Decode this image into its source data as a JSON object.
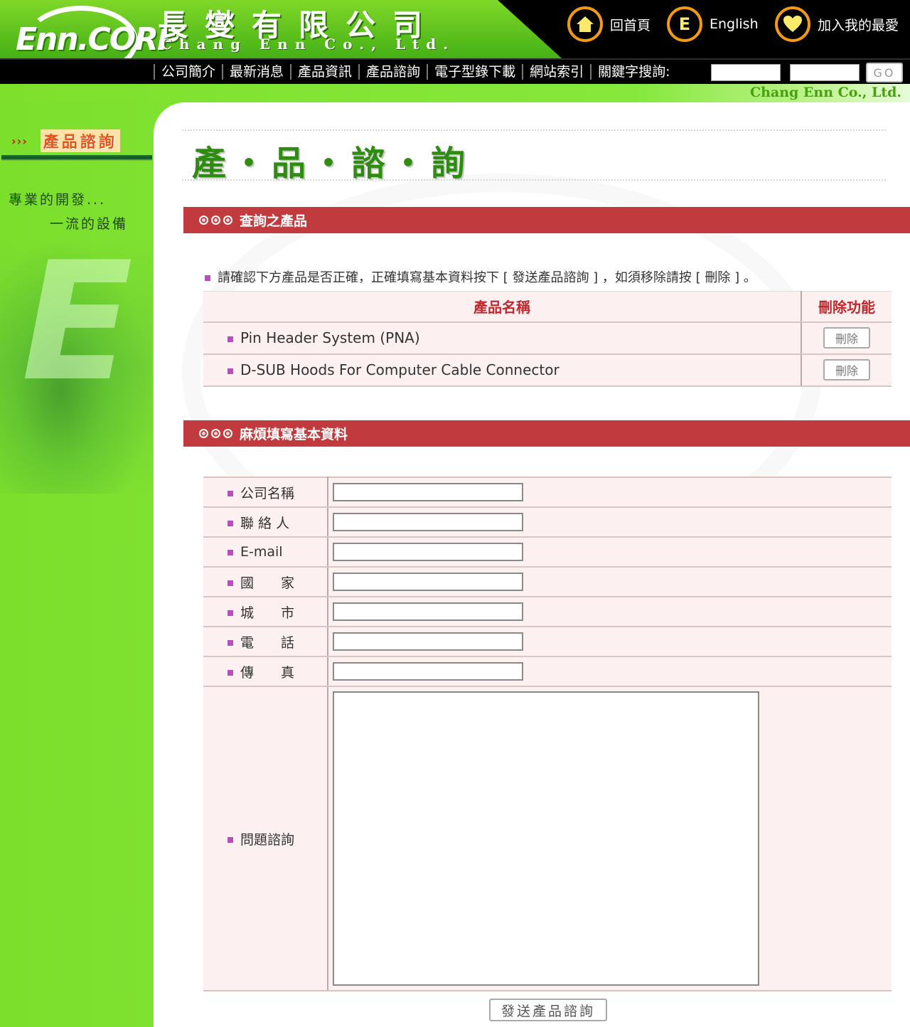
{
  "header": {
    "logo_text": "Enn.CORP",
    "company_cn": "長燮有限公司",
    "company_en": "Chang Enn Co., Ltd.",
    "home_label": "回首頁",
    "english_label": "English",
    "english_icon_letter": "E",
    "favorite_label": "加入我的最愛"
  },
  "nav": {
    "items": [
      "公司簡介",
      "最新消息",
      "產品資訊",
      "產品諮詢",
      "電子型錄下載",
      "網站索引"
    ],
    "keyword_label": "關鍵字搜詢:",
    "go_label": "GO"
  },
  "brand_line": "Chang Enn Co., Ltd.",
  "sidebar": {
    "arrows": "›››",
    "title": "產品諮詢",
    "slogan_line1": "專業的開發...",
    "slogan_line2": "一流的設備"
  },
  "main": {
    "page_title": "產・品・諮・詢",
    "section_products": "查詢之產品",
    "instruction": "請確認下方產品是否正確，正確填寫基本資料按下 [ 發送產品諮詢 ] ，如須移除請按 [ 刪除 ] 。",
    "table_headers": {
      "name": "產品名稱",
      "delete": "刪除功能"
    },
    "products": [
      {
        "name": "Pin Header System (PNA)",
        "delete_label": "刪除"
      },
      {
        "name": "D-SUB Hoods For Computer Cable Connector",
        "delete_label": "刪除"
      }
    ],
    "section_form": "麻煩填寫基本資料",
    "form_labels": {
      "company": "公司名稱",
      "contact": "聯 絡 人",
      "email": "E-mail",
      "country": "國　　家",
      "city": "城　　市",
      "phone": "電　　話",
      "fax": "傳　　真",
      "inquiry": "問題諮詢"
    },
    "submit_label": "發送產品諮詢"
  },
  "colors": {
    "section_bar": "#c13b3e",
    "page_title_green": "#2e8c10",
    "background_green": "#86e83c",
    "table_bg": "#fdf0f0",
    "header_accent": "#f29b12"
  }
}
